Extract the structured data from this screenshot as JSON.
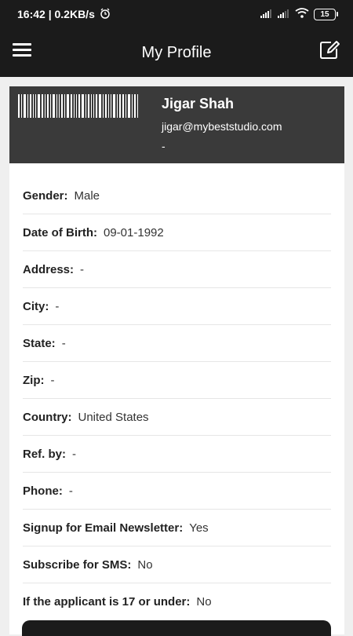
{
  "status_bar": {
    "time": "16:42 | 0.2KB/s",
    "battery": "15"
  },
  "app_bar": {
    "title": "My Profile"
  },
  "profile": {
    "name": "Jigar Shah",
    "email": "jigar@mybeststudio.com",
    "phone": "-"
  },
  "fields": [
    {
      "label": "Gender:",
      "value": "Male"
    },
    {
      "label": "Date of Birth:",
      "value": "09-01-1992"
    },
    {
      "label": "Address:",
      "value": "-"
    },
    {
      "label": "City:",
      "value": "-"
    },
    {
      "label": "State:",
      "value": "-"
    },
    {
      "label": "Zip:",
      "value": "-"
    },
    {
      "label": "Country:",
      "value": "United States"
    },
    {
      "label": "Ref. by:",
      "value": "-"
    },
    {
      "label": "Phone:",
      "value": "-"
    },
    {
      "label": "Signup for Email Newsletter:",
      "value": "Yes"
    },
    {
      "label": "Subscribe for SMS:",
      "value": "No"
    },
    {
      "label": "If the applicant is 17 or under:",
      "value": "No"
    }
  ]
}
